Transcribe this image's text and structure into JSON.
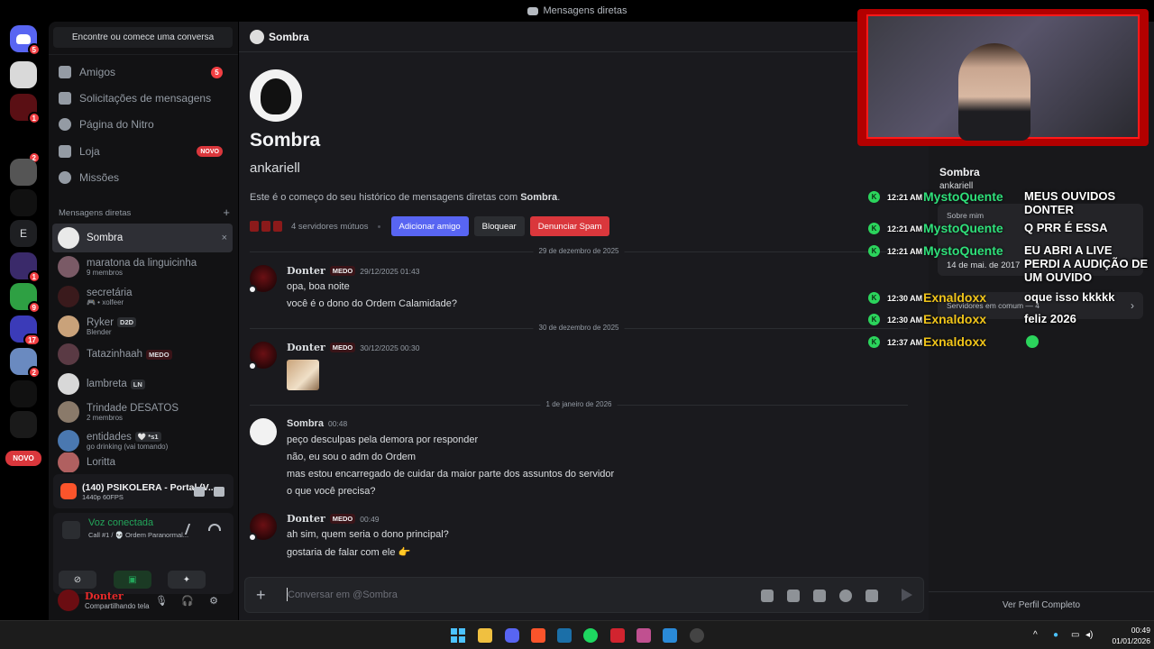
{
  "window": {
    "title": "Mensagens diretas"
  },
  "rail": {
    "home_badge": "5",
    "badges": [
      "1",
      "2",
      "1",
      "9",
      "17",
      "2"
    ],
    "letter_server": "E",
    "novo_label": "NOVO"
  },
  "sidebar": {
    "search_label": "Encontre ou comece uma conversa",
    "nav": [
      {
        "label": "Amigos",
        "badge": "5"
      },
      {
        "label": "Solicitações de mensagens"
      },
      {
        "label": "Página do Nitro"
      },
      {
        "label": "Loja",
        "tag": "NOVO"
      },
      {
        "label": "Missões"
      }
    ],
    "dm_header": "Mensagens diretas",
    "dm_add": "+",
    "dms": [
      {
        "name": "Sombra",
        "close": "×",
        "avatar_color": "#e9e9e9"
      },
      {
        "name": "maratona da linguicinha",
        "sub": "9 membros",
        "avatar_color": "#7a5a66"
      },
      {
        "name": "secretária",
        "sub": "🎮 • xolfeer",
        "avatar_color": "#3a1a1c"
      },
      {
        "name": "Ryker",
        "tag": "D2D",
        "sub": "Blender",
        "avatar_color": "#c9a27a"
      },
      {
        "name": "Tatazinhaah",
        "tag": "MEDO",
        "avatar_color": "#5a3a44"
      },
      {
        "name": "lambreta",
        "tag": "LN",
        "avatar_color": "#d8d8d8"
      },
      {
        "name": "Trindade DESATOS",
        "sub": "2 membros",
        "avatar_color": "#8a7a6a"
      },
      {
        "name": "entidades",
        "tag": "🤍 *s1",
        "sub": "go drinking (vai tomando)",
        "avatar_color": "#4a78b0"
      },
      {
        "name": "Loritta",
        "avatar_color": "#b06060"
      }
    ],
    "activity": {
      "title": "(140) PSIKOLERA - Portal (V...",
      "sub": "1440p 60FPS"
    },
    "voice": {
      "status": "Voz conectada",
      "channel": "Call #1 / 💀 Ordem Paranormal..."
    },
    "user": {
      "name": "Donter",
      "status": "Compartilhando tela"
    }
  },
  "chat": {
    "header_name": "Sombra",
    "intro": {
      "name": "Sombra",
      "username": "ankariell",
      "text_prefix": "Este é o começo do seu histórico de mensagens diretas com ",
      "text_name": "Sombra",
      "text_suffix": ".",
      "mutual": "4 servidores mútuos",
      "add_friend": "Adicionar amigo",
      "block": "Bloquear",
      "report_spam": "Denunciar Spam"
    },
    "dividers": [
      "29 de dezembro de 2025",
      "30 de dezembro de 2025",
      "1 de janeiro de 2026"
    ],
    "messages": [
      {
        "author": "Donter",
        "role": "MEDO",
        "time": "29/12/2025 01:43",
        "lines": [
          "opa, boa noite",
          "você é o dono do Ordem Calamidade?"
        ]
      },
      {
        "author": "Donter",
        "role": "MEDO",
        "time": "30/12/2025 00:30",
        "lines": []
      },
      {
        "author": "Sombra",
        "time": "00:48",
        "lines": [
          "peço desculpas pela demora por responder",
          "não, eu sou o adm do Ordem",
          "mas estou encarregado de cuidar da maior parte dos assuntos do servidor",
          "o que você precisa?"
        ]
      },
      {
        "author": "Donter",
        "role": "MEDO",
        "time": "00:49",
        "lines": [
          "ah sim, quem seria o dono principal?",
          "gostaria de falar com ele 👉"
        ]
      }
    ],
    "composer_placeholder": "Conversar em @Sombra"
  },
  "profile": {
    "name": "Sombra",
    "username": "ankariell",
    "about_label": "Sobre mim",
    "member_since": "14 de mai. de 2017",
    "mutual_servers": "Servidores em comum — 4",
    "view_full": "Ver Perfil Completo"
  },
  "overlay": [
    {
      "time": "12:21 AM",
      "user": "MystoQuente",
      "color": "#2fe07a",
      "msg": "MEUS OUVIDOS DONTER"
    },
    {
      "time": "12:21 AM",
      "user": "MystoQuente",
      "color": "#2fe07a",
      "msg": "Q PRR É ESSA"
    },
    {
      "time": "12:21 AM",
      "user": "MystoQuente",
      "color": "#2fe07a",
      "msg": "EU ABRI A LIVE PERDI A AUDIÇÃO DE UM OUVIDO"
    },
    {
      "time": "12:30 AM",
      "user": "Exnaldoxx",
      "color": "#f0c419",
      "msg": "oque isso kkkkk"
    },
    {
      "time": "12:30 AM",
      "user": "Exnaldoxx",
      "color": "#f0c419",
      "msg": "feliz 2026"
    },
    {
      "time": "12:37 AM",
      "user": "Exnaldoxx",
      "color": "#f0c419",
      "msg": ""
    }
  ],
  "taskbar": {
    "time": "00:49",
    "date": "01/01/2026"
  }
}
